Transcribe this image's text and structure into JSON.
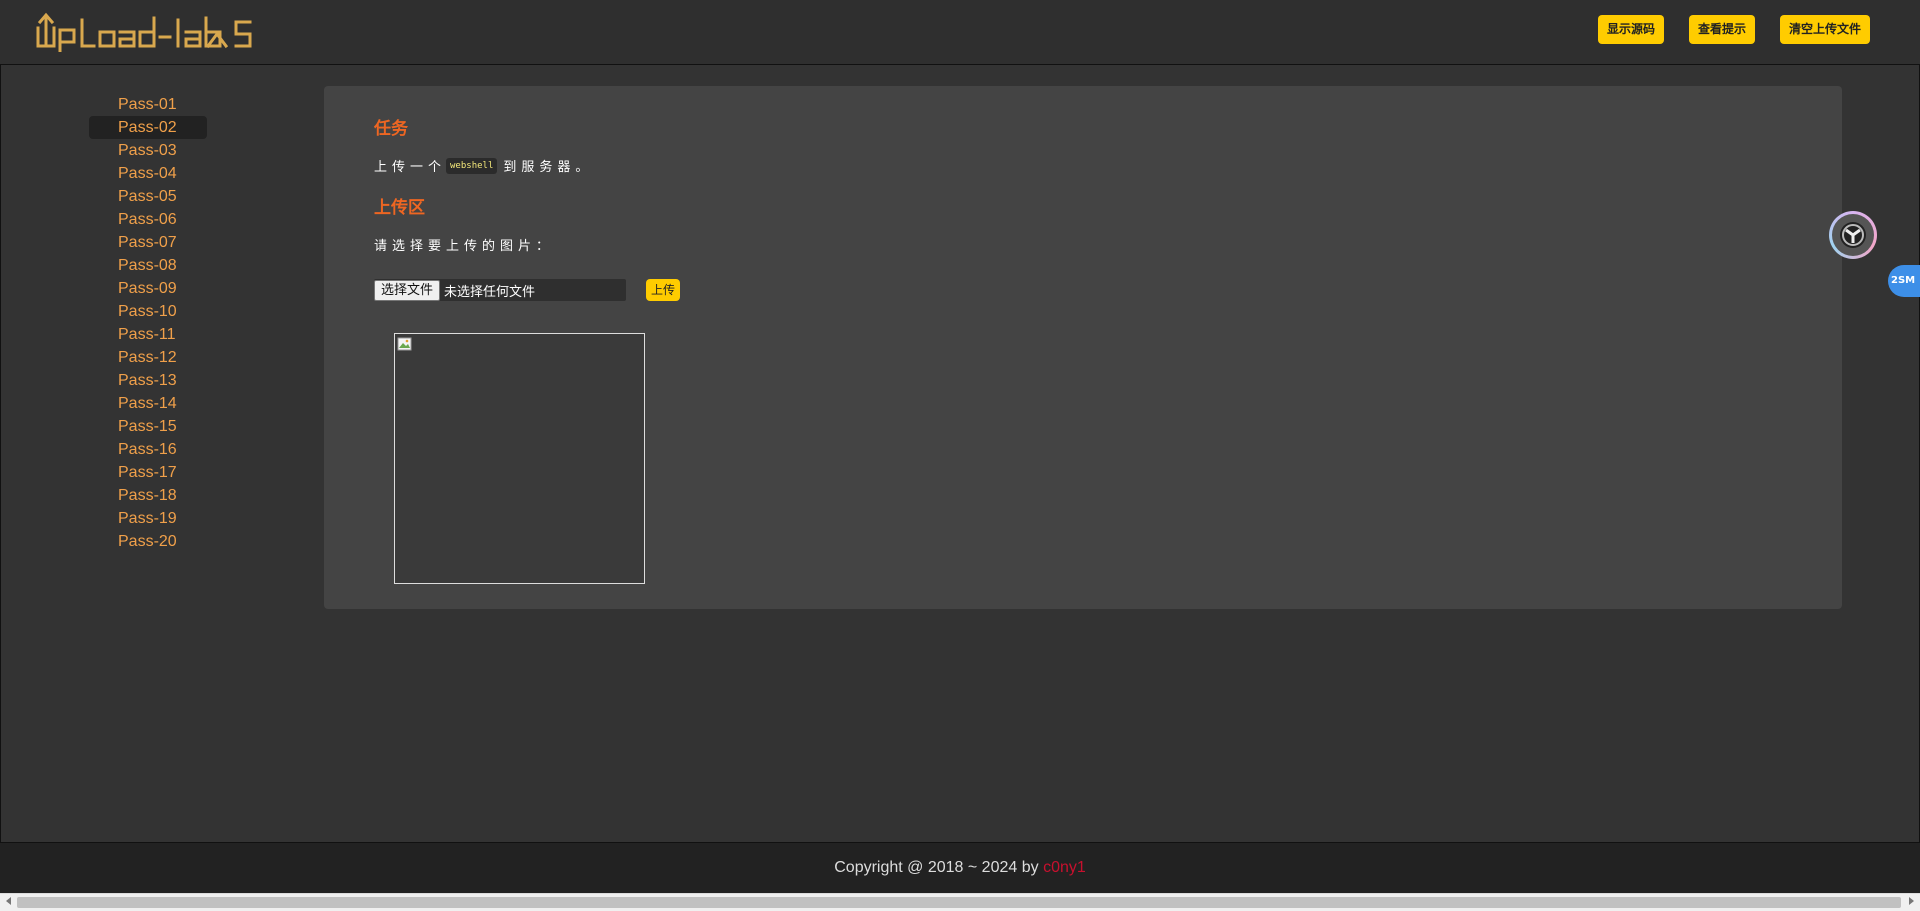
{
  "header": {
    "logo_text": "UpLoad-labs",
    "buttons": [
      {
        "label": "显示源码"
      },
      {
        "label": "查看提示"
      },
      {
        "label": "清空上传文件"
      }
    ]
  },
  "sidebar": {
    "active": "Pass-02",
    "items": [
      {
        "label": "Pass-01"
      },
      {
        "label": "Pass-02"
      },
      {
        "label": "Pass-03"
      },
      {
        "label": "Pass-04"
      },
      {
        "label": "Pass-05"
      },
      {
        "label": "Pass-06"
      },
      {
        "label": "Pass-07"
      },
      {
        "label": "Pass-08"
      },
      {
        "label": "Pass-09"
      },
      {
        "label": "Pass-10"
      },
      {
        "label": "Pass-11"
      },
      {
        "label": "Pass-12"
      },
      {
        "label": "Pass-13"
      },
      {
        "label": "Pass-14"
      },
      {
        "label": "Pass-15"
      },
      {
        "label": "Pass-16"
      },
      {
        "label": "Pass-17"
      },
      {
        "label": "Pass-18"
      },
      {
        "label": "Pass-19"
      },
      {
        "label": "Pass-20"
      }
    ]
  },
  "task": {
    "title": "任务",
    "text_before": "上传一个",
    "code": "webshell",
    "text_after": "到服务器。"
  },
  "upload_area": {
    "title": "上传区",
    "prompt": "请选择要上传的图片：",
    "file_button_label": "选择文件",
    "file_status": "未选择任何文件",
    "upload_button_label": "上传"
  },
  "floating": {
    "chip_label": "2SM"
  },
  "footer": {
    "copyright": "Copyright @ 2018 ~ 2024 by ",
    "author": "c0ny1"
  },
  "colors": {
    "accent_yellow": "#ffcc00",
    "sidebar_link": "#f0a04a",
    "section_title": "#ee6622",
    "author": "#c8102e"
  }
}
